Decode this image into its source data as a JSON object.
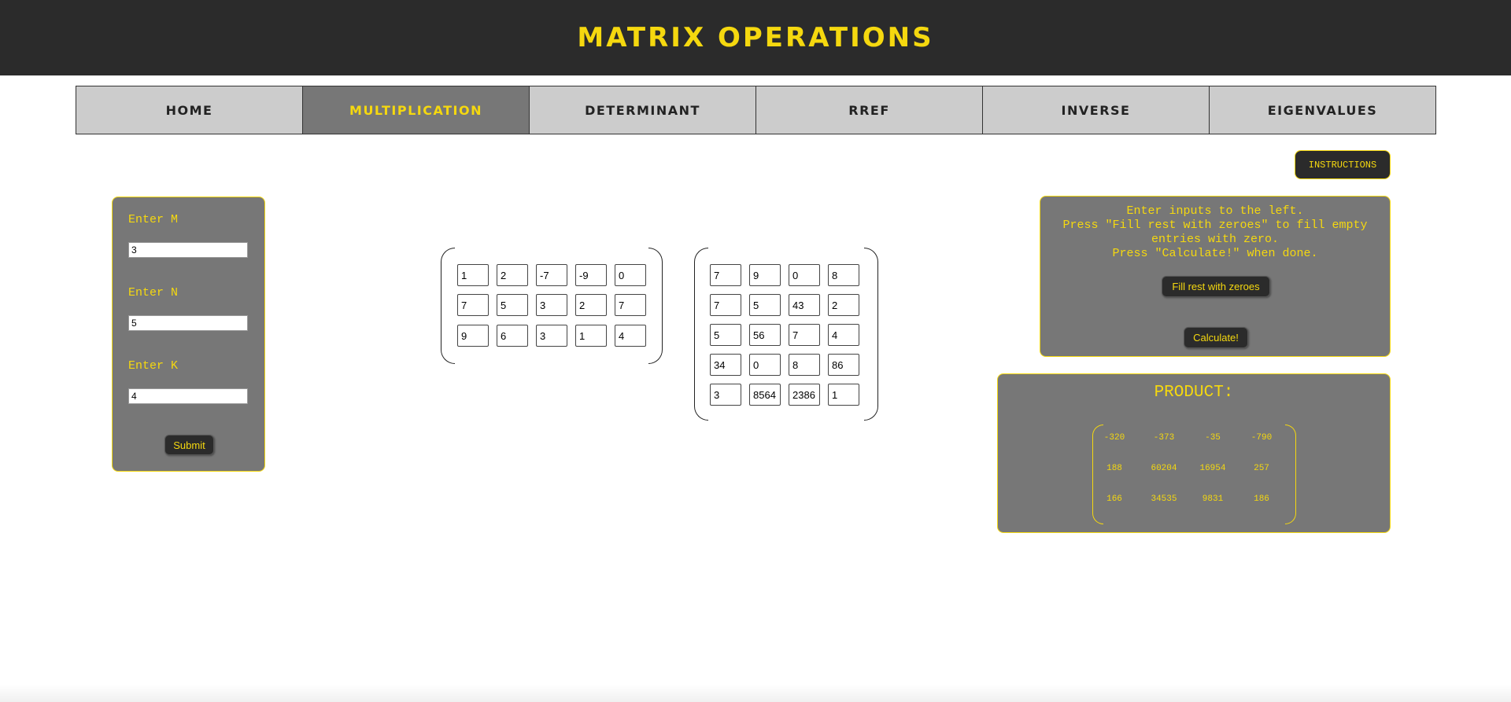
{
  "header": {
    "title": "MATRIX OPERATIONS"
  },
  "nav": {
    "items": [
      {
        "label": "HOME",
        "active": false
      },
      {
        "label": "MULTIPLICATION",
        "active": true
      },
      {
        "label": "DETERMINANT",
        "active": false
      },
      {
        "label": "RREF",
        "active": false
      },
      {
        "label": "INVERSE",
        "active": false
      },
      {
        "label": "EIGENVALUES",
        "active": false
      }
    ]
  },
  "instructions_button": "INSTRUCTIONS",
  "dimensions": {
    "m_label": "Enter M",
    "m_value": "3",
    "n_label": "Enter N",
    "n_value": "5",
    "k_label": "Enter K",
    "k_value": "4",
    "submit_label": "Submit"
  },
  "matrix_a": [
    [
      "1",
      "2",
      "-7",
      "-9",
      "0"
    ],
    [
      "7",
      "5",
      "3",
      "2",
      "7"
    ],
    [
      "9",
      "6",
      "3",
      "1",
      "4"
    ]
  ],
  "matrix_b": [
    [
      "7",
      "9",
      "0",
      "8"
    ],
    [
      "7",
      "5",
      "43",
      "2"
    ],
    [
      "5",
      "56",
      "7",
      "4"
    ],
    [
      "34",
      "0",
      "8",
      "86"
    ],
    [
      "3",
      "8564",
      "2386",
      "1"
    ]
  ],
  "info": {
    "lines": [
      "Enter inputs to the left.",
      "Press \"Fill rest with zeroes\" to fill empty",
      "entries with zero.",
      "Press \"Calculate!\" when done."
    ],
    "fill_label": "Fill rest with zeroes",
    "calculate_label": "Calculate!"
  },
  "product": {
    "title": "PRODUCT:",
    "rows": [
      [
        "-320",
        "-373",
        "-35",
        "-790"
      ],
      [
        "188",
        "60204",
        "16954",
        "257"
      ],
      [
        "166",
        "34535",
        "9831",
        "186"
      ]
    ]
  },
  "colors": {
    "accent": "#f5d80f",
    "header_bg": "#2b2b2b",
    "nav_bg": "#cccccc",
    "panel_bg": "#777777"
  }
}
